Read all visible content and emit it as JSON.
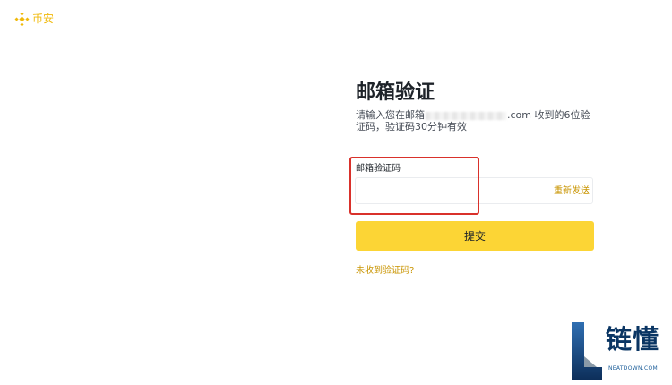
{
  "header": {
    "brand": "币安",
    "logo_icon": "binance-diamond-icon"
  },
  "colors": {
    "brand_yellow": "#f0b90b",
    "button_yellow": "#fcd535",
    "link_gold": "#c99400",
    "highlight_red": "#d9312b"
  },
  "verify": {
    "title": "邮箱验证",
    "description_prefix": "请输入您在邮箱",
    "description_suffix": ".com 收到的6位验证码，验证码30分钟有效",
    "code_label": "邮箱验证码",
    "code_value": "",
    "resend_label": "重新发送",
    "submit_label": "提交",
    "no_code_link": "未收到验证码?"
  },
  "watermark": {
    "text": "链懂",
    "subtext": "NEATDOWN.COM"
  }
}
